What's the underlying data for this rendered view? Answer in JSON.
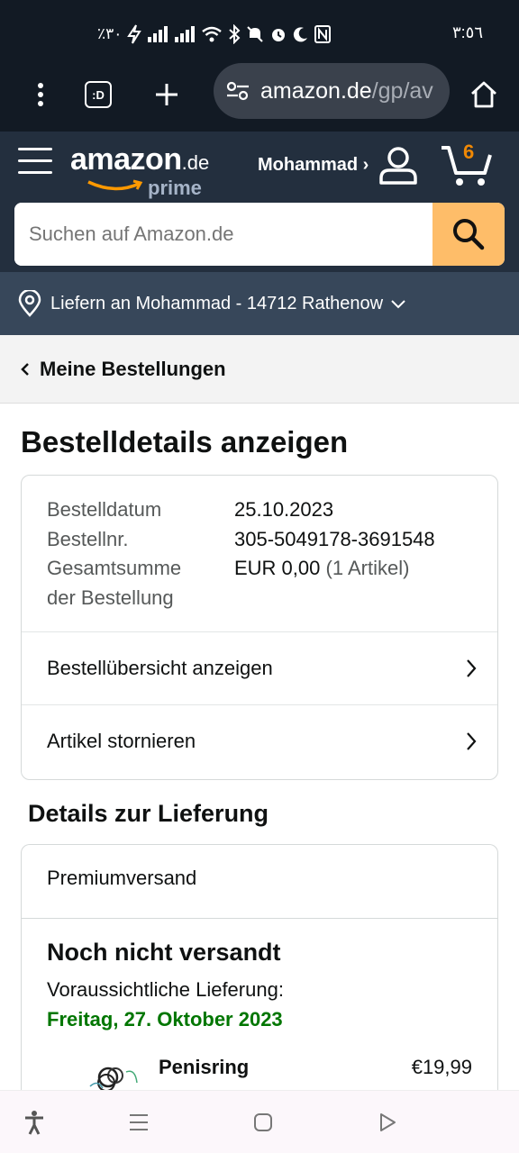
{
  "status_bar": {
    "battery": "٪٣٠",
    "time": "٣:٥٦"
  },
  "browser": {
    "tabs_icon_label": ":D",
    "url_host": "amazon.de",
    "url_path": "/gp/av"
  },
  "header": {
    "logo_word": "amazon",
    "logo_tld": ".de",
    "logo_sub": "prime",
    "account_name": "Mohammad ›",
    "cart_count": "6",
    "search_placeholder": "Suchen auf Amazon.de",
    "accent_color": "#febd69"
  },
  "deliver_to": "Liefern an Mohammad - 14712 Rathenow",
  "breadcrumb": "Meine Bestellungen",
  "page_title": "Bestelldetails anzeigen",
  "order_info": {
    "rows": [
      {
        "key": "Bestelldatum",
        "value": "25.10.2023",
        "extra": ""
      },
      {
        "key": "Bestellnr.",
        "value": "305-5049178-3691548",
        "extra": ""
      },
      {
        "key": "Gesamtsumme",
        "value": "EUR 0,00",
        "extra": "(1 Artikel)"
      },
      {
        "key": "der Bestellung",
        "value": "",
        "extra": ""
      }
    ],
    "links": [
      "Bestellübersicht anzeigen",
      "Artikel stornieren"
    ]
  },
  "delivery": {
    "section_title": "Details zur Lieferung",
    "method": "Premiumversand",
    "status": "Noch nicht versandt",
    "eta_label": "Voraussichtliche Lieferung:",
    "eta_date": "Freitag, 27. Oktober 2023",
    "eta_color": "#007600",
    "item_name": "Penisring",
    "item_price": "€19,99"
  },
  "icons": {
    "menu": "kebab-menu-icon",
    "tabs": "tab-switcher-icon",
    "new_tab": "plus-icon",
    "site_settings": "tune-icon",
    "home": "home-icon",
    "hamburger": "hamburger-icon",
    "user": "user-icon",
    "cart": "cart-icon",
    "search": "search-icon",
    "location": "location-pin-icon"
  }
}
